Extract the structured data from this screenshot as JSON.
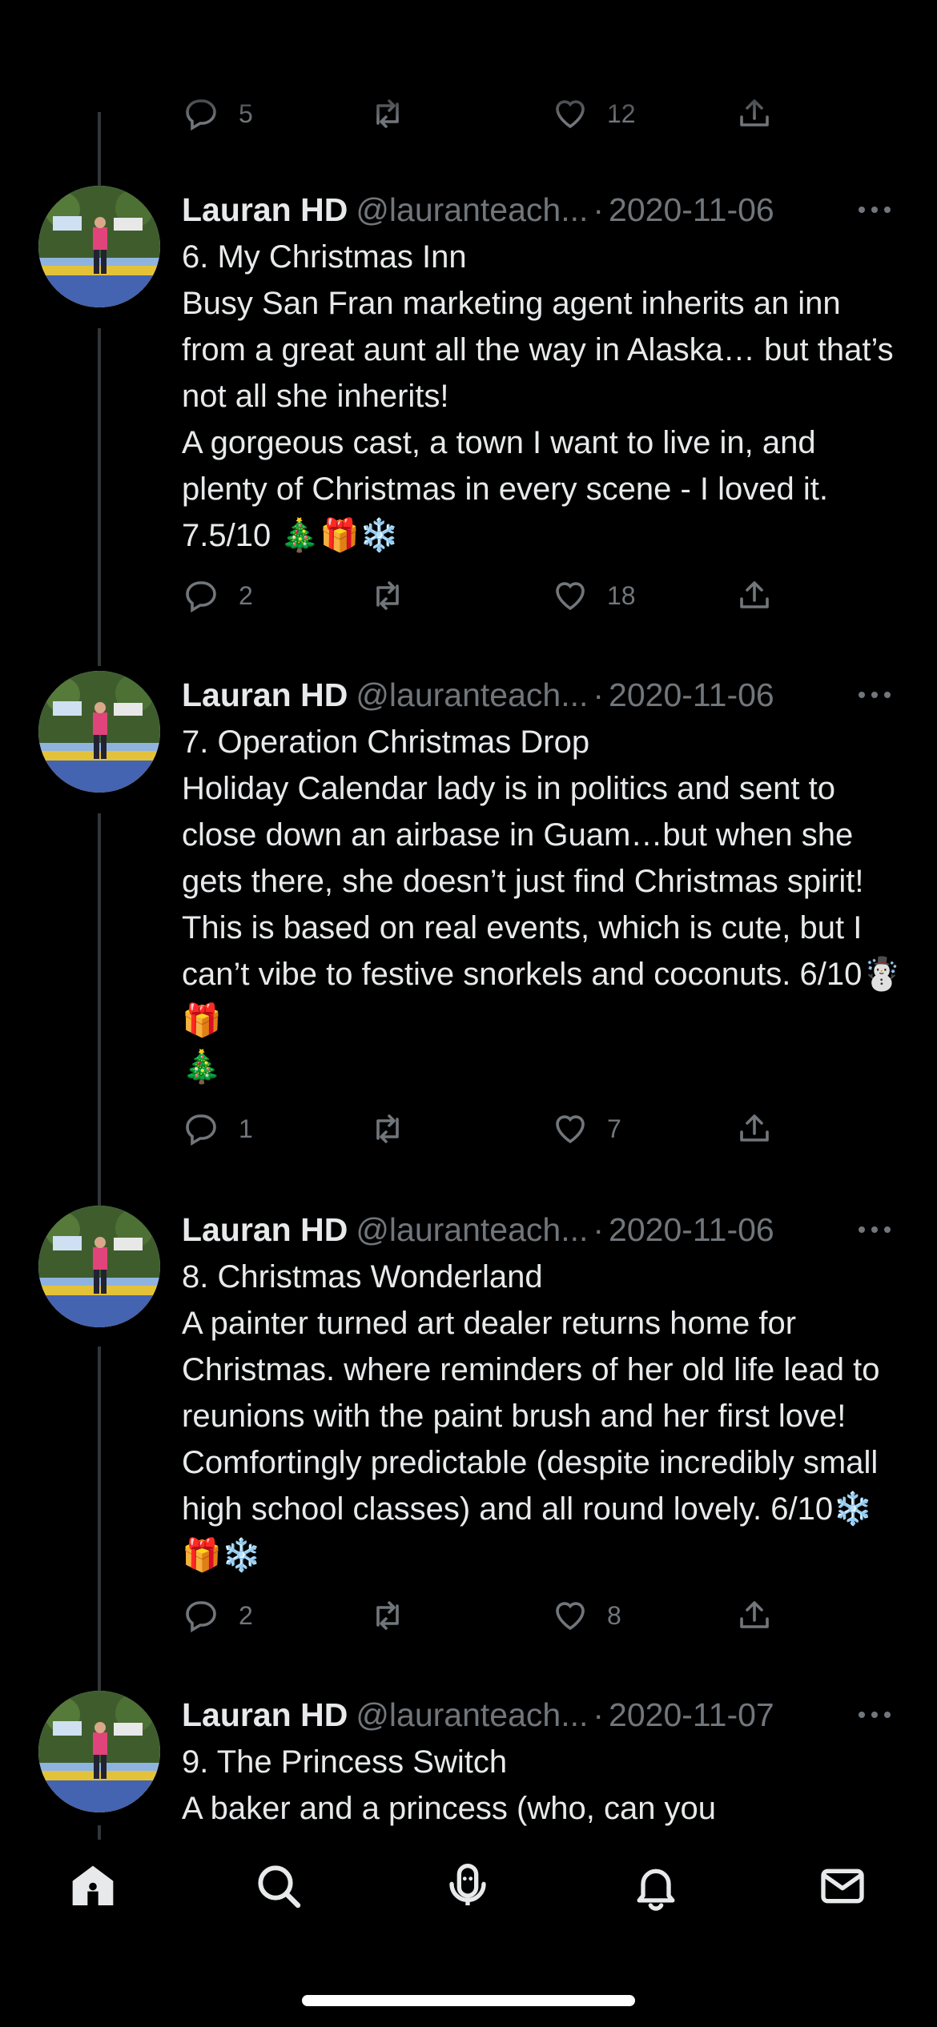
{
  "author": {
    "name": "Lauran HD",
    "handle": "@lauranteach..."
  },
  "top_partial_actions": {
    "reply": "5",
    "like": "12"
  },
  "tweets": [
    {
      "date": "2020-11-06",
      "body": "6. My Christmas Inn\nBusy San Fran marketing agent inherits an inn from a great aunt all the way in Alaska… but that’s not all she inherits!\nA gorgeous cast, a town I want to live in, and plenty of Christmas in every scene - I loved it. 7.5/10 🎄🎁❄️",
      "replies": "2",
      "retweets": "",
      "likes": "18"
    },
    {
      "date": "2020-11-06",
      "body": "7. Operation Christmas Drop\nHoliday Calendar lady is in politics and sent to close down an airbase in Guam…but when she gets there, she doesn’t just find Christmas spirit! This is based on real events, which is cute, but I can’t vibe to festive snorkels and coconuts. 6/10☃️🎁\n🎄",
      "replies": "1",
      "retweets": "",
      "likes": "7"
    },
    {
      "date": "2020-11-06",
      "body": "8. Christmas Wonderland\nA painter turned art dealer returns home for Christmas. where reminders of her old life lead to reunions with the paint brush and her first love!  Comfortingly predictable (despite incredibly small high school classes) and all round lovely. 6/10❄️🎁❄️",
      "replies": "2",
      "retweets": "",
      "likes": "8"
    },
    {
      "date": "2020-11-07",
      "body": "9. The Princess Switch\nA baker and a princess (who, can you"
    }
  ],
  "tabbar": {
    "tabs": [
      "home-icon",
      "search-icon",
      "spaces-icon",
      "notifications-icon",
      "messages-icon"
    ],
    "active": "home-icon"
  },
  "colors": {
    "background": "#000000",
    "text": "#e7e9ea",
    "secondary_text": "#71767b",
    "thread_line": "#333639"
  }
}
